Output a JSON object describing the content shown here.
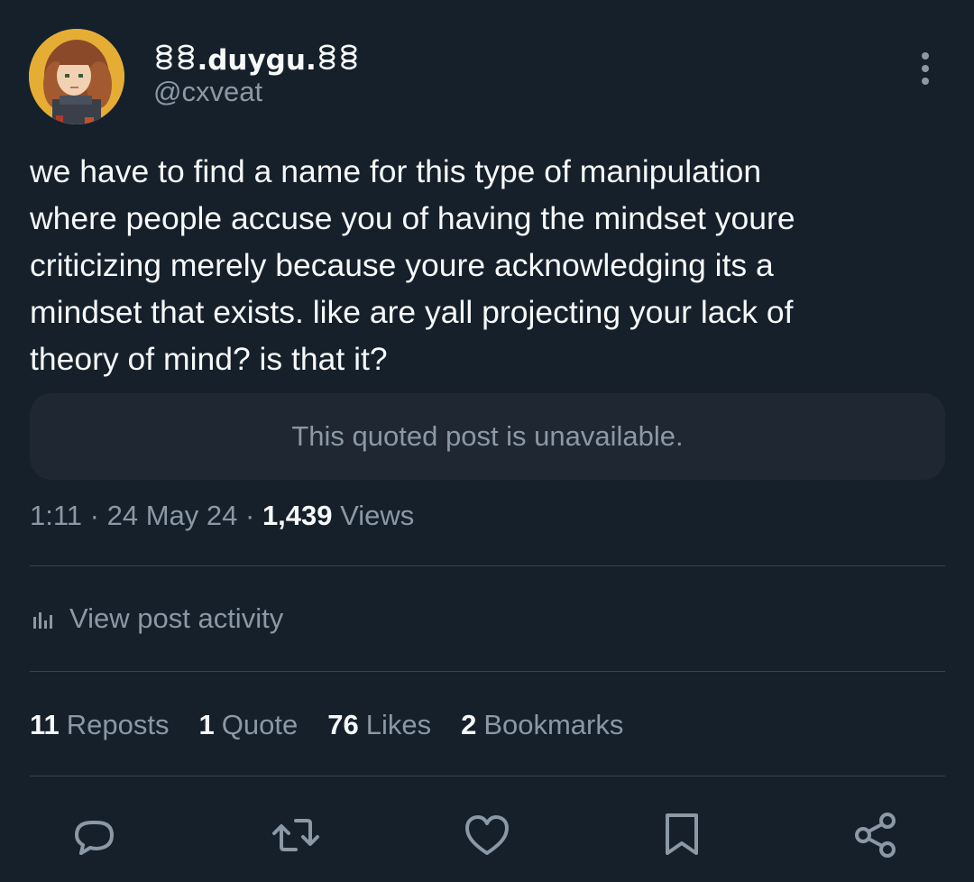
{
  "author": {
    "display_name": "ꊞꊞ.duygu.ꊞꊞ",
    "handle": "@cxveat"
  },
  "tweet": {
    "text": "we have to find a name for this type of manipulation\nwhere people accuse you of having the mindset youre\ncriticizing merely because youre acknowledging its a\nmindset that exists. like are yall projecting your lack of\ntheory of mind? is that it?",
    "quoted_post_notice": "This quoted post is unavailable."
  },
  "meta": {
    "time": "1:11",
    "separator": " · ",
    "date": "24 May 24",
    "views_count": "1,439",
    "views_label": "Views"
  },
  "activity": {
    "label": "View post activity",
    "icon": "bar-chart-icon"
  },
  "stats": {
    "reposts": {
      "count": "11",
      "label": "Reposts"
    },
    "quotes": {
      "count": "1",
      "label": "Quote"
    },
    "likes": {
      "count": "76",
      "label": "Likes"
    },
    "bookmarks": {
      "count": "2",
      "label": "Bookmarks"
    }
  },
  "actions": [
    "reply-icon",
    "repost-icon",
    "like-icon",
    "bookmark-icon",
    "share-icon"
  ],
  "colors": {
    "background": "#15202b",
    "text_primary": "#f7f9f9",
    "text_secondary": "#8b98a5",
    "divider": "#38444d",
    "quote_bg": "#1e2732"
  }
}
